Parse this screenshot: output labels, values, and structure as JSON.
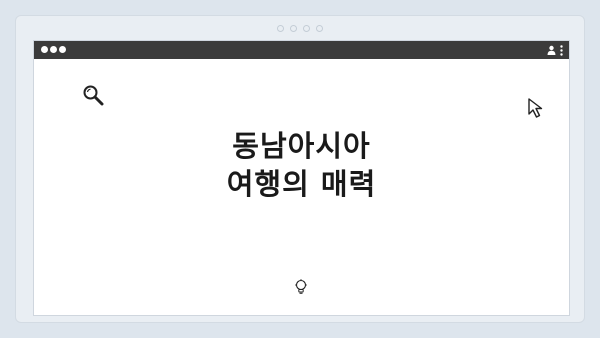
{
  "pager": {
    "dots": [
      "dot-1",
      "dot-2",
      "dot-3",
      "dot-4"
    ]
  },
  "browser": {
    "window_controls": [
      "close",
      "minimize",
      "maximize"
    ],
    "toolbar_icons": [
      "profile-icon",
      "kebab-menu-icon"
    ]
  },
  "content": {
    "headline_line1": "동남아시아",
    "headline_line2": "여행의 매력",
    "icons": [
      "search-icon",
      "cursor-icon",
      "lightbulb-icon"
    ]
  },
  "colors": {
    "page_background": "#dde5ed",
    "titlebar": "#3b3b3b",
    "window_background": "#ffffff",
    "text": "#1a1a1a"
  }
}
